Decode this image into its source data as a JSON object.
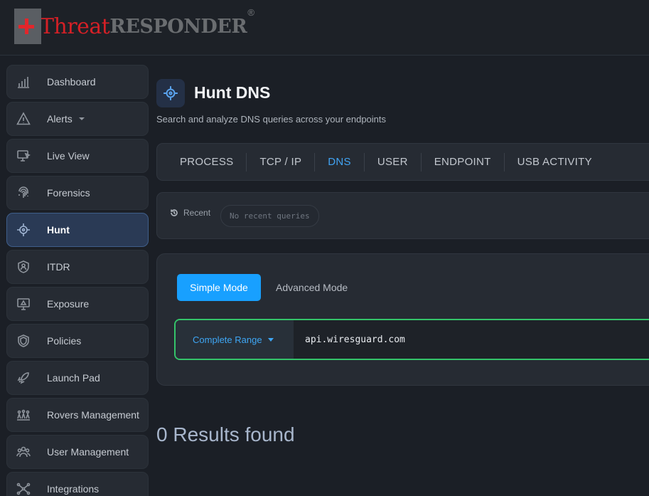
{
  "header": {
    "logo_threat": "Threat",
    "logo_responder": "RESPONDER",
    "logo_reg": "®"
  },
  "sidebar": {
    "items": [
      {
        "label": "Dashboard",
        "icon": "chart-bars-icon"
      },
      {
        "label": "Alerts",
        "icon": "warning-triangle-icon"
      },
      {
        "label": "Live View",
        "icon": "monitor-cursor-icon"
      },
      {
        "label": "Forensics",
        "icon": "fingerprint-icon"
      },
      {
        "label": "Hunt",
        "icon": "crosshair-icon",
        "active": true
      },
      {
        "label": "ITDR",
        "icon": "user-shield-icon"
      },
      {
        "label": "Exposure",
        "icon": "monitor-alert-icon"
      },
      {
        "label": "Policies",
        "icon": "shield-icon"
      },
      {
        "label": "Launch Pad",
        "icon": "rocket-icon"
      },
      {
        "label": "Rovers Management",
        "icon": "rovers-icon"
      },
      {
        "label": "User Management",
        "icon": "users-icon"
      },
      {
        "label": "Integrations",
        "icon": "network-icon"
      }
    ]
  },
  "main": {
    "title": "Hunt DNS",
    "subtitle": "Search and analyze DNS queries across your endpoints",
    "tabs": [
      "PROCESS",
      "TCP / IP",
      "DNS",
      "USER",
      "ENDPOINT",
      "USB ACTIVITY"
    ],
    "active_tab": "DNS",
    "recent": {
      "label": "Recent",
      "empty_text": "No recent queries"
    },
    "modes": {
      "simple": "Simple Mode",
      "advanced": "Advanced Mode"
    },
    "search": {
      "range_label": "Complete Range",
      "value": "api.wiresguard.com"
    },
    "results_text": "0 Results found"
  },
  "colors": {
    "accent": "#18a0ff",
    "active_tab": "#41a3f2",
    "search_border": "#34c46a",
    "logo_red": "#d42026"
  }
}
